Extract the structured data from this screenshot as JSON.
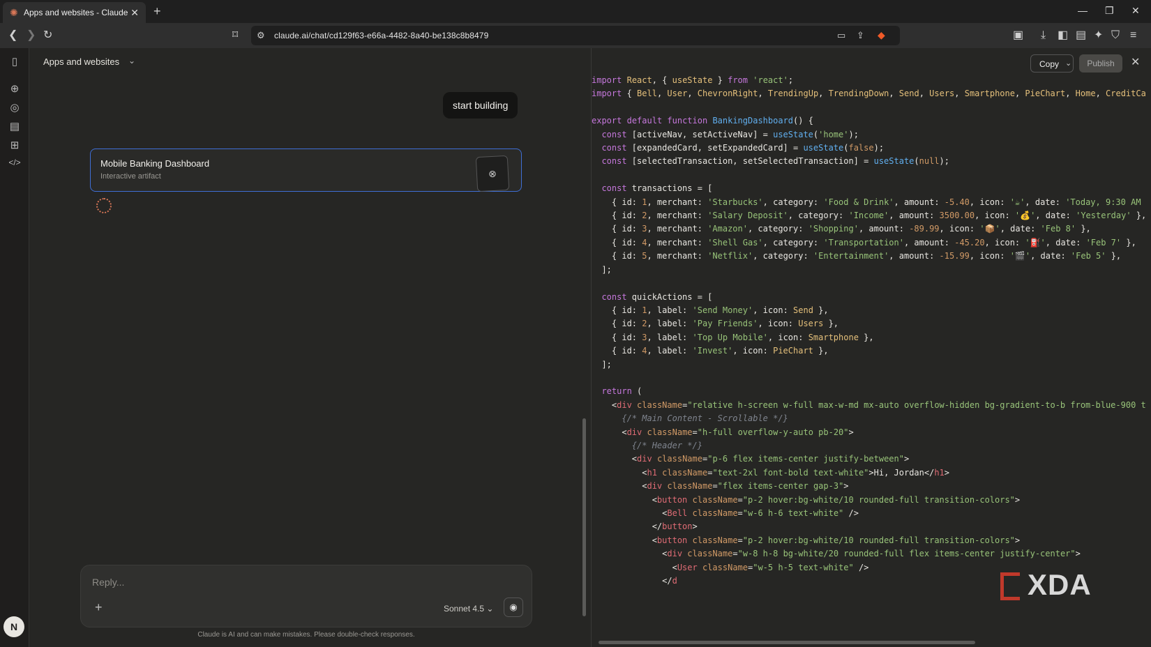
{
  "browser": {
    "tab_title": "Apps and websites - Claude",
    "url": "claude.ai/chat/cd129f63-e66a-4482-8a40-be138c8b8479"
  },
  "chat": {
    "conversation_title": "Apps and websites",
    "user_message": "start building",
    "artifact_title": "Mobile Banking Dashboard",
    "artifact_subtitle": "Interactive artifact",
    "reply_placeholder": "Reply...",
    "model": "Sonnet 4.5",
    "disclaimer": "Claude is AI and can make mistakes. Please double-check responses.",
    "avatar_initial": "N"
  },
  "code_panel": {
    "copy_label": "Copy",
    "publish_label": "Publish",
    "lines": [
      "import React, { useState } from 'react';",
      "import { Bell, User, ChevronRight, TrendingUp, TrendingDown, Send, Users, Smartphone, PieChart, Home, CreditCa",
      "",
      "export default function BankingDashboard() {",
      "  const [activeNav, setActiveNav] = useState('home');",
      "  const [expandedCard, setExpandedCard] = useState(false);",
      "  const [selectedTransaction, setSelectedTransaction] = useState(null);",
      "",
      "  const transactions = [",
      "    { id: 1, merchant: 'Starbucks', category: 'Food & Drink', amount: -5.40, icon: '☕', date: 'Today, 9:30 AM",
      "    { id: 2, merchant: 'Salary Deposit', category: 'Income', amount: 3500.00, icon: '💰', date: 'Yesterday' },",
      "    { id: 3, merchant: 'Amazon', category: 'Shopping', amount: -89.99, icon: '📦', date: 'Feb 8' },",
      "    { id: 4, merchant: 'Shell Gas', category: 'Transportation', amount: -45.20, icon: '⛽', date: 'Feb 7' },",
      "    { id: 5, merchant: 'Netflix', category: 'Entertainment', amount: -15.99, icon: '🎬', date: 'Feb 5' },",
      "  ];",
      "",
      "  const quickActions = [",
      "    { id: 1, label: 'Send Money', icon: Send },",
      "    { id: 2, label: 'Pay Friends', icon: Users },",
      "    { id: 3, label: 'Top Up Mobile', icon: Smartphone },",
      "    { id: 4, label: 'Invest', icon: PieChart },",
      "  ];",
      "",
      "  return (",
      "    <div className=\"relative h-screen w-full max-w-md mx-auto overflow-hidden bg-gradient-to-b from-blue-900 t",
      "      {/* Main Content - Scrollable */}",
      "      <div className=\"h-full overflow-y-auto pb-20\">",
      "        {/* Header */}",
      "        <div className=\"p-6 flex items-center justify-between\">",
      "          <h1 className=\"text-2xl font-bold text-white\">Hi, Jordan</h1>",
      "          <div className=\"flex items-center gap-3\">",
      "            <button className=\"p-2 hover:bg-white/10 rounded-full transition-colors\">",
      "              <Bell className=\"w-6 h-6 text-white\" />",
      "            </button>",
      "            <button className=\"p-2 hover:bg-white/10 rounded-full transition-colors\">",
      "              <div className=\"w-8 h-8 bg-white/20 rounded-full flex items-center justify-center\">",
      "                <User className=\"w-5 h-5 text-white\" />",
      "              </d"
    ]
  },
  "watermark": "XDA"
}
